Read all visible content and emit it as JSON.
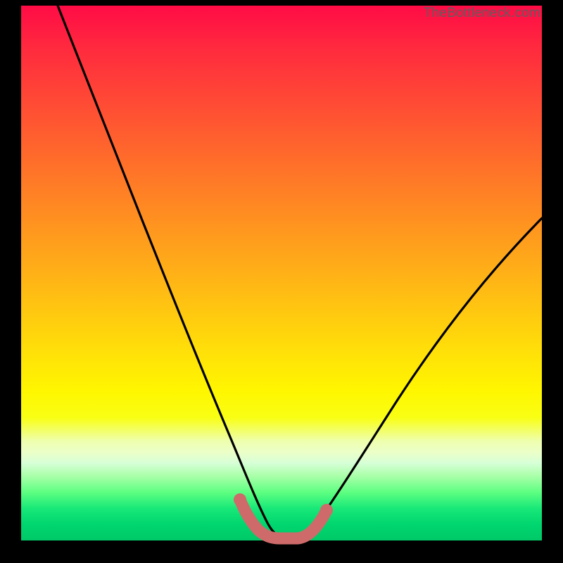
{
  "watermark": "TheBottleneck.com",
  "colors": {
    "frame": "#000000",
    "curve": "#000000",
    "highlight": "#cf6a6a",
    "gradient_top": "#ff0b46",
    "gradient_mid": "#fff600",
    "gradient_bottom": "#00c967"
  },
  "chart_data": {
    "type": "line",
    "title": "",
    "xlabel": "",
    "ylabel": "",
    "xlim": [
      0,
      100
    ],
    "ylim": [
      0,
      100
    ],
    "grid": false,
    "legend_position": "none",
    "series": [
      {
        "name": "bottleneck-curve",
        "x_pct": [
          7,
          10,
          15,
          20,
          25,
          30,
          35,
          38,
          41,
          44,
          46.5,
          49,
          52,
          57,
          62,
          68,
          75,
          82,
          90,
          100
        ],
        "y_pct": [
          100,
          93,
          82,
          70,
          58,
          46,
          32,
          23,
          14,
          6,
          1.5,
          0,
          0,
          4,
          11,
          19,
          28,
          36,
          44,
          53
        ]
      },
      {
        "name": "bottom-highlight",
        "x_pct": [
          41,
          43,
          45,
          47,
          49,
          51,
          53
        ],
        "y_pct": [
          7,
          2,
          0.5,
          0,
          0,
          1,
          4
        ]
      }
    ],
    "annotations": [
      {
        "text": "TheBottleneck.com",
        "position": "top-right"
      }
    ]
  }
}
